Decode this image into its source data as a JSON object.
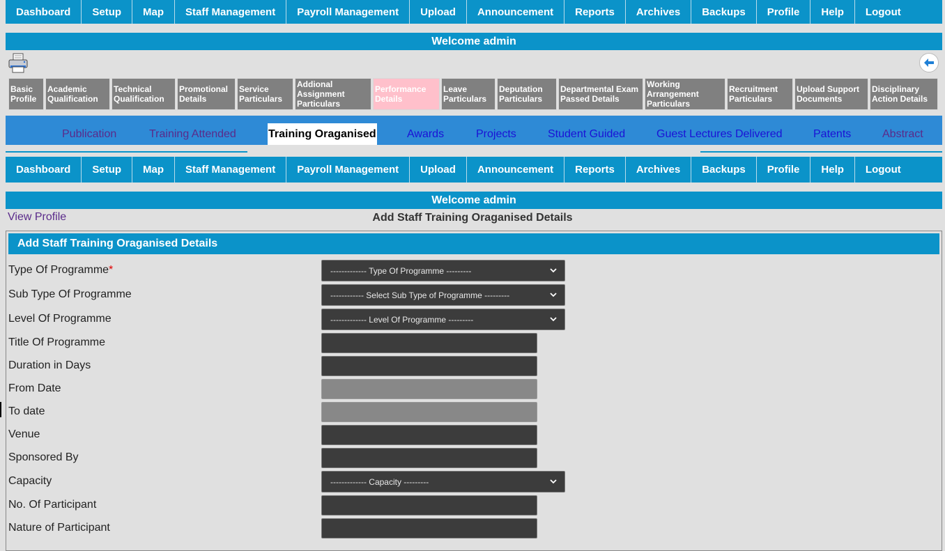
{
  "nav": {
    "items": [
      "Dashboard",
      "Setup",
      "Map",
      "Staff Management",
      "Payroll Management",
      "Upload",
      "Announcement",
      "Reports",
      "Archives",
      "Backups",
      "Profile",
      "Help",
      "Logout"
    ]
  },
  "welcome": "Welcome admin",
  "icons": {
    "print": "printer-icon",
    "back": "back-arrow-icon"
  },
  "tabs": [
    {
      "label": "Basic Profile"
    },
    {
      "label": "Academic Qualification"
    },
    {
      "label": "Technical Qualification"
    },
    {
      "label": "Promotional Details"
    },
    {
      "label": "Service Particulars"
    },
    {
      "label": "Addional Assignment Particulars"
    },
    {
      "label": "Performance Details",
      "active": true
    },
    {
      "label": "Leave Particulars"
    },
    {
      "label": "Deputation Particulars"
    },
    {
      "label": "Departmental Exam Passed Details"
    },
    {
      "label": "Working Arrangement Particulars"
    },
    {
      "label": "Recruitment Particulars"
    },
    {
      "label": "Upload Support Documents"
    },
    {
      "label": "Disciplinary Action Details"
    }
  ],
  "subtabs": [
    "Publication",
    "Training Attended",
    "Training Oraganised",
    "Awards",
    "Projects",
    "Student Guided",
    "Guest Lectures Delivered",
    "Patents",
    "Abstract"
  ],
  "active_subtab": "Training Oraganised",
  "view_profile": "View Profile",
  "page_title": "Add Staff Training Oraganised Details",
  "form": {
    "header": "Add Staff Training Oraganised Details",
    "fields": {
      "type_of_programme": {
        "label": "Type Of Programme",
        "required": "*",
        "placeholder": "------------- Type Of Programme ---------"
      },
      "sub_type_of_programme": {
        "label": "Sub Type Of Programme",
        "placeholder": "------------ Select Sub Type of Programme ---------"
      },
      "level_of_programme": {
        "label": "Level Of Programme",
        "placeholder": "------------- Level Of Programme ---------"
      },
      "title_of_programme": {
        "label": "Title Of Programme",
        "value": ""
      },
      "duration_in_days": {
        "label": "Duration in Days",
        "value": ""
      },
      "from_date": {
        "label": "From Date",
        "value": ""
      },
      "to_date": {
        "label": "To date",
        "value": ""
      },
      "venue": {
        "label": "Venue",
        "value": ""
      },
      "sponsored_by": {
        "label": "Sponsored By",
        "value": ""
      },
      "capacity": {
        "label": "Capacity",
        "placeholder": "------------- Capacity ---------"
      },
      "no_of_participant": {
        "label": "No. Of Participant",
        "value": ""
      },
      "nature_of_participant": {
        "label": "Nature of Participant",
        "value": ""
      }
    }
  },
  "colors": {
    "primary": "#0b93c9",
    "tab_gray": "#808080",
    "tab_active": "#ffc0cb",
    "subtab_bar": "#2e8ad6",
    "input_dark": "#3c3c3c",
    "required": "#e00000"
  }
}
